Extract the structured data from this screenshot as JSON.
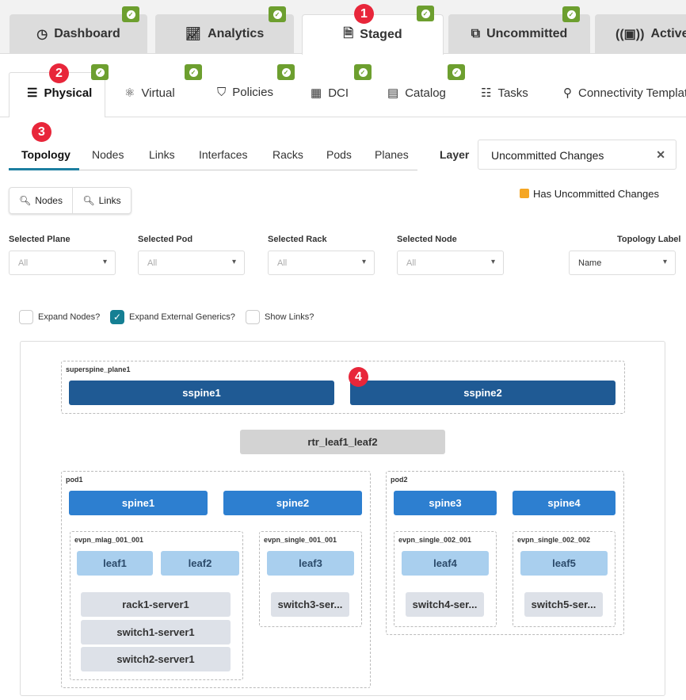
{
  "top_tabs": [
    {
      "label": "Dashboard",
      "icon": "dashboard-icon"
    },
    {
      "label": "Analytics",
      "icon": "chart-icon"
    },
    {
      "label": "Staged",
      "icon": "staged-icon",
      "active": true
    },
    {
      "label": "Uncommitted",
      "icon": "uncommitted-icon"
    },
    {
      "label": "Active",
      "icon": "active-icon"
    }
  ],
  "sub_tabs": [
    {
      "label": "Physical",
      "active": true
    },
    {
      "label": "Virtual"
    },
    {
      "label": "Policies"
    },
    {
      "label": "DCI"
    },
    {
      "label": "Catalog"
    },
    {
      "label": "Tasks"
    },
    {
      "label": "Connectivity Templates"
    }
  ],
  "callouts": [
    "1",
    "2",
    "3",
    "4"
  ],
  "view_tabs": [
    "Topology",
    "Nodes",
    "Links",
    "Interfaces",
    "Racks",
    "Pods",
    "Planes"
  ],
  "layer": {
    "label": "Layer",
    "value": "Uncommitted Changes"
  },
  "search_buttons": [
    "Nodes",
    "Links"
  ],
  "legend": {
    "label": "Has Uncommitted Changes",
    "color": "#f5a623"
  },
  "filters": [
    {
      "label": "Selected Plane",
      "value": "All"
    },
    {
      "label": "Selected Pod",
      "value": "All"
    },
    {
      "label": "Selected Rack",
      "value": "All"
    },
    {
      "label": "Selected Node",
      "value": "All"
    },
    {
      "label": "Topology Label",
      "value": "Name"
    }
  ],
  "checkboxes": [
    {
      "label": "Expand Nodes?",
      "checked": false
    },
    {
      "label": "Expand External Generics?",
      "checked": true
    },
    {
      "label": "Show Links?",
      "checked": false
    }
  ],
  "topology": {
    "plane": {
      "name": "superspine_plane1",
      "nodes": [
        "sspine1",
        "sspine2"
      ]
    },
    "external": "rtr_leaf1_leaf2",
    "pods": [
      {
        "name": "pod1",
        "spines": [
          "spine1",
          "spine2"
        ],
        "racks": [
          {
            "name": "evpn_mlag_001_001",
            "leafs": [
              "leaf1",
              "leaf2"
            ],
            "servers": [
              "rack1-server1",
              "switch1-server1",
              "switch2-server1"
            ]
          },
          {
            "name": "evpn_single_001_001",
            "leafs": [
              "leaf3"
            ],
            "servers": [
              "switch3-ser..."
            ]
          }
        ]
      },
      {
        "name": "pod2",
        "spines": [
          "spine3",
          "spine4"
        ],
        "racks": [
          {
            "name": "evpn_single_002_001",
            "leafs": [
              "leaf4"
            ],
            "servers": [
              "switch4-ser..."
            ]
          },
          {
            "name": "evpn_single_002_002",
            "leafs": [
              "leaf5"
            ],
            "servers": [
              "switch5-ser..."
            ]
          }
        ]
      }
    ]
  }
}
